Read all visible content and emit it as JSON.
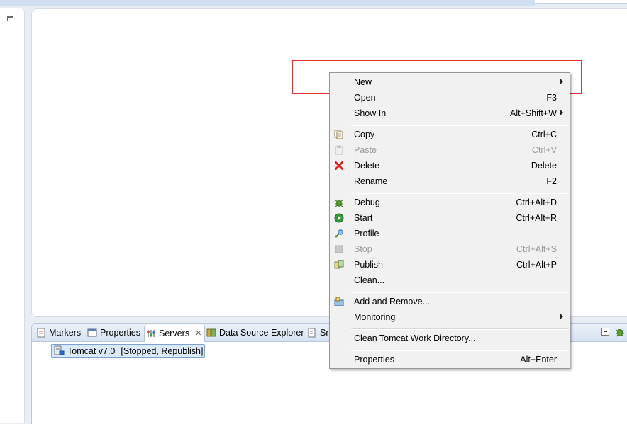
{
  "bottom_tabs": [
    {
      "label": "Markers",
      "icon": "markers-icon"
    },
    {
      "label": "Properties",
      "icon": "properties-icon"
    },
    {
      "label": "Servers",
      "icon": "servers-icon",
      "active": true
    },
    {
      "label": "Data Source Explorer",
      "icon": "data-source-explorer-icon"
    },
    {
      "label": "Sn",
      "icon": "snippets-icon"
    }
  ],
  "server": {
    "name": "Tomcat v7.0",
    "status": "[Stopped, Republish]"
  },
  "context_menu": {
    "new": {
      "label": "New",
      "shortcut": ""
    },
    "open": {
      "label": "Open",
      "shortcut": "F3"
    },
    "show_in": {
      "label": "Show In",
      "shortcut": "Alt+Shift+W"
    },
    "copy": {
      "label": "Copy",
      "shortcut": "Ctrl+C"
    },
    "paste": {
      "label": "Paste",
      "shortcut": "Ctrl+V"
    },
    "delete": {
      "label": "Delete",
      "shortcut": "Delete"
    },
    "rename": {
      "label": "Rename",
      "shortcut": "F2"
    },
    "debug": {
      "label": "Debug",
      "shortcut": "Ctrl+Alt+D"
    },
    "start": {
      "label": "Start",
      "shortcut": "Ctrl+Alt+R"
    },
    "profile": {
      "label": "Profile",
      "shortcut": ""
    },
    "stop": {
      "label": "Stop",
      "shortcut": "Ctrl+Alt+S"
    },
    "publish": {
      "label": "Publish",
      "shortcut": "Ctrl+Alt+P"
    },
    "clean": {
      "label": "Clean...",
      "shortcut": ""
    },
    "add_remove": {
      "label": "Add and Remove...",
      "shortcut": ""
    },
    "monitoring": {
      "label": "Monitoring",
      "shortcut": ""
    },
    "clean_tomcat": {
      "label": "Clean Tomcat Work Directory...",
      "shortcut": ""
    },
    "properties": {
      "label": "Properties",
      "shortcut": "Alt+Enter"
    }
  },
  "colors": {
    "highlight_box": "#e5322f",
    "menu_bg": "#f1f1f1",
    "selection": "#dbe9f9"
  }
}
